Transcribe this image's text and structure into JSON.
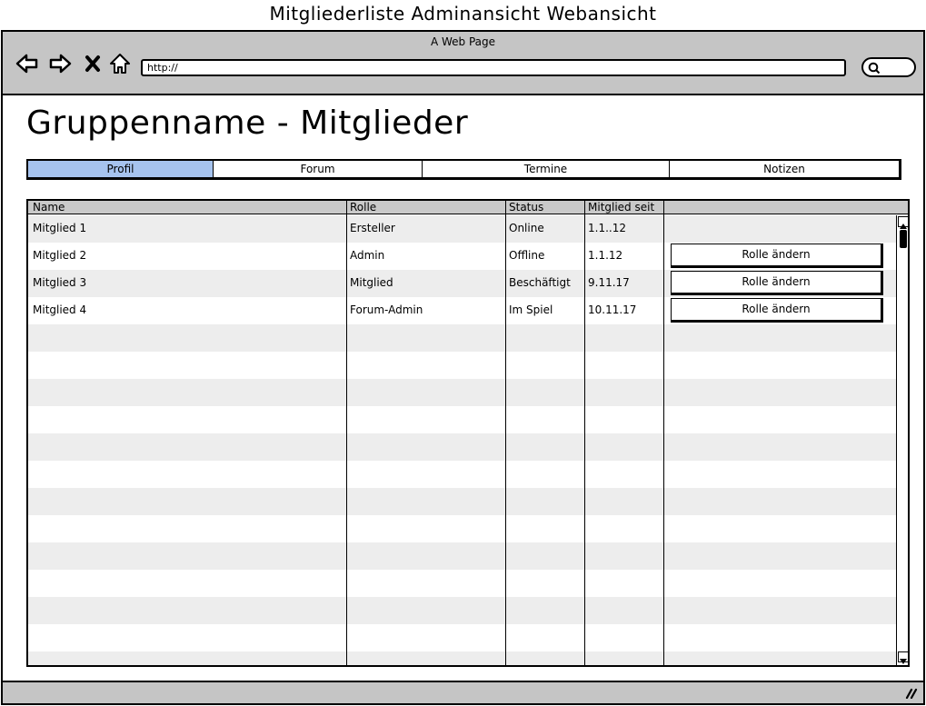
{
  "caption": "Mitgliederliste Adminansicht Webansicht",
  "browser": {
    "window_title": "A Web Page",
    "url": "http://",
    "icons": [
      "back-arrow-icon",
      "forward-arrow-icon",
      "close-x-icon",
      "home-icon",
      "search-icon",
      "resize-grip-icon"
    ]
  },
  "page": {
    "title": "Gruppenname - Mitglieder"
  },
  "tabs": [
    {
      "label": "Profil",
      "active": true
    },
    {
      "label": "Forum"
    },
    {
      "label": "Termine"
    },
    {
      "label": "Notizen"
    }
  ],
  "table": {
    "columns": [
      "Name",
      "Rolle",
      "Status",
      "Mitglied seit",
      ""
    ],
    "rows": [
      {
        "name": "Mitglied 1",
        "rolle": "Ersteller",
        "status": "Online",
        "seit": "1.1..12",
        "action": ""
      },
      {
        "name": "Mitglied 2",
        "rolle": "Admin",
        "status": "Offline",
        "seit": "1.1.12",
        "action": "Rolle ändern"
      },
      {
        "name": "Mitglied 3",
        "rolle": "Mitglied",
        "status": "Beschäftigt",
        "seit": "9.11.17",
        "action": "Rolle ändern"
      },
      {
        "name": "Mitglied 4",
        "rolle": "Forum-Admin",
        "status": "Im Spiel",
        "seit": "10.11.17",
        "action": "Rolle ändern"
      }
    ]
  },
  "colors": {
    "active_tab": "#a6c3ee",
    "chrome": "#c5c5c5",
    "stripe": "#ededed"
  }
}
